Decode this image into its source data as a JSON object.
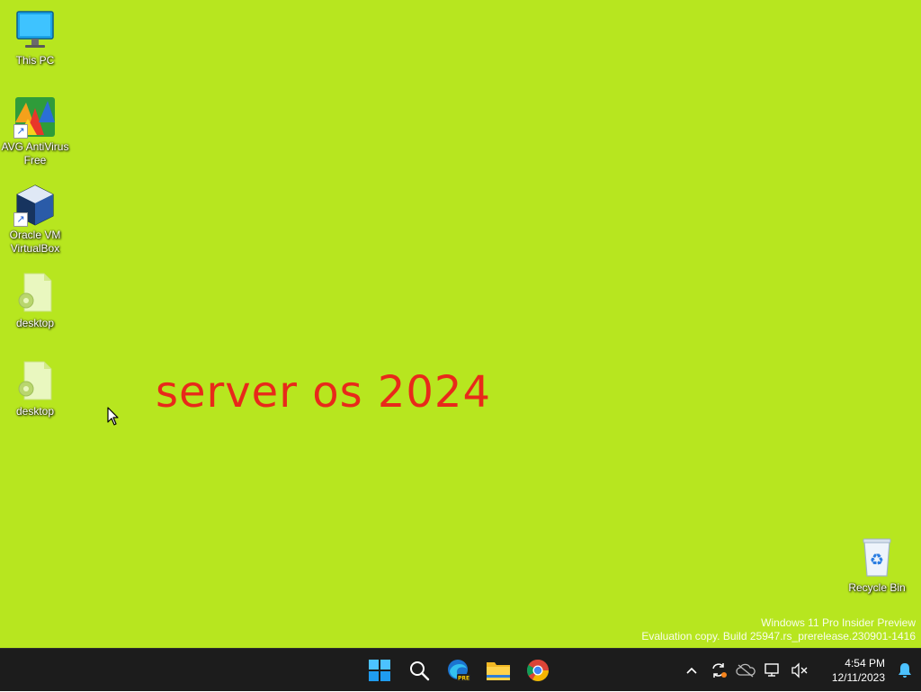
{
  "desktop": {
    "background_color": "#b7e61f",
    "wallpaper_text": "server os 2024",
    "wallpaper_text_color": "#e8291a",
    "icons": [
      {
        "label": "This PC",
        "icon": "monitor-icon"
      },
      {
        "label": "AVG AntiVirus Free",
        "icon": "avg-antivirus-icon"
      },
      {
        "label": "Oracle VM VirtualBox",
        "icon": "virtualbox-icon"
      },
      {
        "label": "desktop",
        "icon": "config-file-icon"
      },
      {
        "label": "desktop",
        "icon": "config-file-icon"
      },
      {
        "label": "Recycle Bin",
        "icon": "recycle-bin-icon"
      }
    ],
    "watermark": {
      "line1": "Windows 11 Pro Insider Preview",
      "line2": "Evaluation copy. Build 25947.rs_prerelease.230901-1416"
    }
  },
  "taskbar": {
    "apps": [
      {
        "name": "Start",
        "icon": "windows-start-icon"
      },
      {
        "name": "Search",
        "icon": "search-icon"
      },
      {
        "name": "Microsoft Edge Preview",
        "icon": "edge-pre-icon"
      },
      {
        "name": "File Explorer",
        "icon": "file-explorer-icon"
      },
      {
        "name": "Google Chrome",
        "icon": "chrome-icon"
      }
    ],
    "tray": {
      "icons": [
        "chevron-up-icon",
        "sync-update-icon",
        "onedrive-icon",
        "network-icon",
        "volume-muted-icon"
      ],
      "time": "4:54 PM",
      "date": "12/11/2023",
      "notification_icon": "bell-icon"
    }
  }
}
